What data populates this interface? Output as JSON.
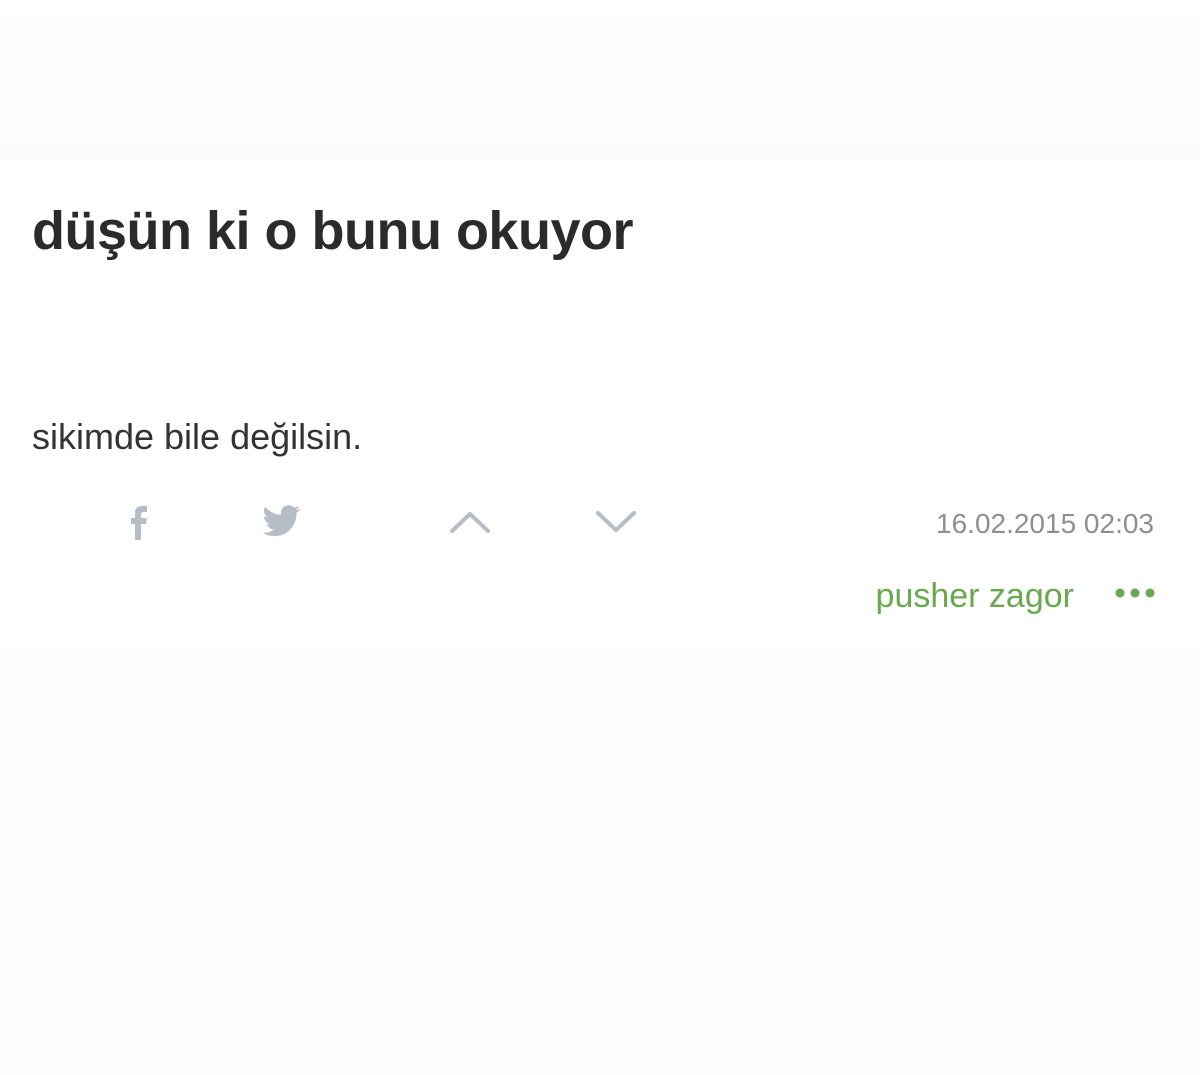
{
  "entry": {
    "title": "düşün ki o bunu okuyor",
    "body": "sikimde bile değilsin.",
    "date": "16.02.2015 02:03",
    "author": "pusher zagor"
  },
  "icons": {
    "facebook": "facebook-icon",
    "twitter": "twitter-icon",
    "upvote": "chevron-up-icon",
    "downvote": "chevron-down-icon",
    "more": "more-dots-icon"
  },
  "colors": {
    "title": "#2b2b2b",
    "text": "#333333",
    "muted": "#8f8f8f",
    "icon": "#b7bdc6",
    "author": "#69a84f"
  }
}
